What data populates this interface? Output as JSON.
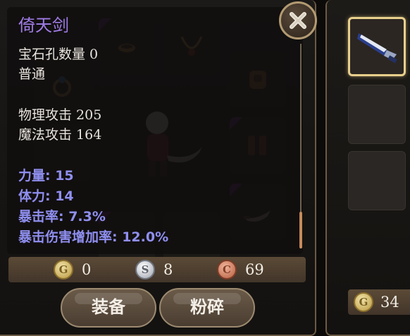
{
  "item": {
    "name": "倚天剑",
    "gem_slots_line": "宝石孔数量 0",
    "quality": "普通",
    "physical_attack_line": "物理攻击 205",
    "magic_attack_line": "魔法攻击 164",
    "bonuses": [
      "力量: 15",
      "体力: 14",
      "暴击率: 7.3%",
      "暴击伤害增加率: 12.0%"
    ]
  },
  "currency": {
    "gold": {
      "symbol": "G",
      "amount": "0"
    },
    "silver": {
      "symbol": "S",
      "amount": "8"
    },
    "copper": {
      "symbol": "C",
      "amount": "69"
    }
  },
  "buttons": {
    "equip": "装备",
    "dismantle": "粉碎"
  },
  "side_panel": {
    "coin_symbol": "G",
    "coin_amount": "34"
  },
  "icons": {
    "close": "close-x-icon",
    "weapon": "blue-blade-weapon-icon"
  },
  "colors": {
    "item_name": "#a07ce6",
    "bonus_text": "#8f8ff0",
    "panel_border": "#6b5a44",
    "selected_border": "#e8cf8c",
    "rarity_corner": "#6a2a8c"
  }
}
